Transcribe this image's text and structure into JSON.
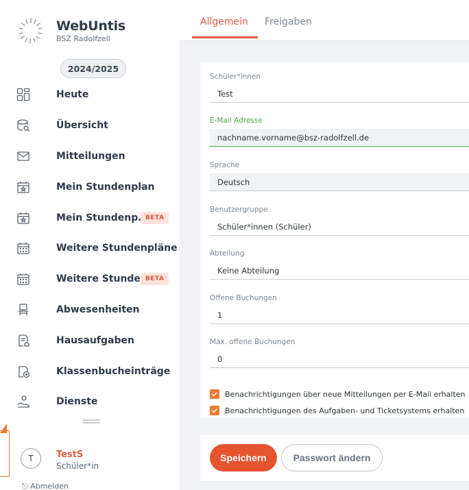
{
  "brand": {
    "title": "WebUntis",
    "subtitle": "BSZ Radolfzell"
  },
  "school_year": "2024/2025",
  "nav": {
    "items": [
      {
        "label": "Heute",
        "icon": "dashboard-grid-icon"
      },
      {
        "label": "Übersicht",
        "icon": "overview-icon"
      },
      {
        "label": "Mitteilungen",
        "icon": "envelope-icon"
      },
      {
        "label": "Mein Stundenplan",
        "icon": "calendar-star-icon"
      },
      {
        "label": "Mein Stundenp…",
        "icon": "calendar-star-icon",
        "badge": "BETA"
      },
      {
        "label": "Weitere Stundenpläne",
        "icon": "calendar-grid-icon"
      },
      {
        "label": "Weitere Stunde…",
        "icon": "calendar-grid-icon",
        "badge": "BETA"
      },
      {
        "label": "Abwesenheiten",
        "icon": "chair-icon"
      },
      {
        "label": "Hausaufgaben",
        "icon": "homework-icon"
      },
      {
        "label": "Klassenbucheinträge",
        "icon": "classbook-add-icon"
      },
      {
        "label": "Dienste",
        "icon": "service-person-icon"
      }
    ]
  },
  "user": {
    "initial": "T",
    "name": "TestS",
    "role": "Schüler*in",
    "next_item": "Abmelden"
  },
  "tabs": {
    "active": "Allgemein",
    "inactive": "Freigaben"
  },
  "form": {
    "fields": [
      {
        "label": "Schüler*innen",
        "value": "Test"
      },
      {
        "label": "E-Mail Adresse",
        "value": "nachname.vorname@bsz-radolfzell.de"
      },
      {
        "label": "Sprache",
        "value": "Deutsch"
      },
      {
        "label": "Benutzergruppe",
        "value": "Schüler*innen (Schüler)"
      },
      {
        "label": "Abteilung",
        "value": "Keine Abteilung"
      },
      {
        "label": "Offene Buchungen",
        "value": "1"
      },
      {
        "label": "Max. offene Buchungen",
        "value": "0"
      }
    ],
    "checkboxes": [
      {
        "label": "Benachrichtigungen über neue Mitteilungen per E-Mail erhalten",
        "checked": true
      },
      {
        "label": "Benachrichtigungen des Aufgaben- und Ticketsystems erhalten",
        "checked": true
      }
    ]
  },
  "buttons": {
    "save": "Speichern",
    "change_password": "Passwort ändern"
  },
  "colors": {
    "accent": "#e5532f",
    "active_field": "#4aa84b",
    "checkbox": "#f07a2f"
  }
}
